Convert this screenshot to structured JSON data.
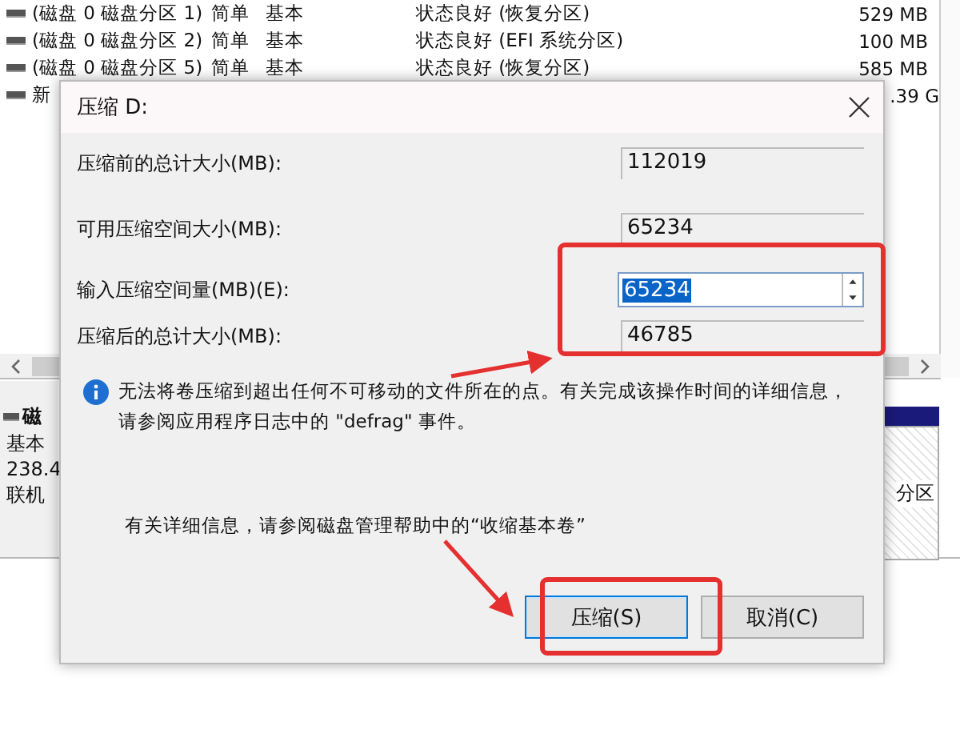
{
  "disk_list": {
    "rows": [
      {
        "name": "(磁盘 0 磁盘分区 1)",
        "layout": "简单",
        "type": "基本",
        "status": "状态良好 (恢复分区)",
        "size": "529 MB"
      },
      {
        "name": "(磁盘 0 磁盘分区 2)",
        "layout": "简单",
        "type": "基本",
        "status": "状态良好 (EFI 系统分区)",
        "size": "100 MB"
      },
      {
        "name": "(磁盘 0 磁盘分区 5)",
        "layout": "简单",
        "type": "基本",
        "status": "状态良好 (恢复分区)",
        "size": "585 MB"
      },
      {
        "name": "新",
        "size": ".39 G"
      }
    ]
  },
  "disk_panel": {
    "disk_label": "磁",
    "lines": [
      "基本",
      "238.4",
      "联机"
    ],
    "partition_label": "分区"
  },
  "dialog": {
    "title": "压缩 D:",
    "fields": [
      {
        "label": "压缩前的总计大小(MB):",
        "value": "112019",
        "kind": "readonly"
      },
      {
        "label": "可用压缩空间大小(MB):",
        "value": "65234",
        "kind": "readonly"
      },
      {
        "label": "输入压缩空间量(MB)(E):",
        "value": "65234",
        "kind": "spinner",
        "text_selected": true
      },
      {
        "label": "压缩后的总计大小(MB):",
        "value": "46785",
        "kind": "readonly"
      }
    ],
    "info": "无法将卷压缩到超出任何不可移动的文件所在的点。有关完成该操作时间的详细信息，请参阅应用程序日志中的 \"defrag\" 事件。",
    "help": "有关详细信息，请参阅磁盘管理帮助中的“收缩基本卷”",
    "buttons": [
      {
        "label": "压缩(S)",
        "default": true
      },
      {
        "label": "取消(C)",
        "default": false
      }
    ]
  }
}
